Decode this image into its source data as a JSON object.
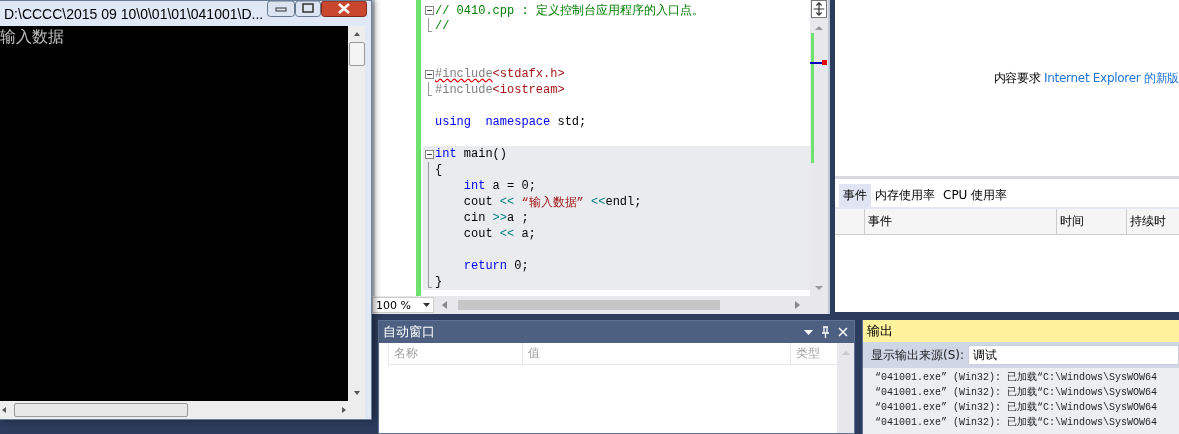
{
  "console": {
    "title": "D:\\CCCC\\2015 09 10\\0\\01\\01\\041001\\D...",
    "text": "输入数据"
  },
  "editor": {
    "regions": [
      {
        "shaded": false,
        "lines": [
          {
            "kind": "start",
            "tokens": [
              {
                "kind": "comment",
                "text": "// 0410.cpp : 定义控制台应用程序的入口点。",
                "error": false
              }
            ]
          },
          {
            "kind": "end",
            "tokens": [
              {
                "kind": "comment",
                "text": "//",
                "error": false
              }
            ]
          },
          {
            "kind": "plain"
          },
          {
            "kind": "plain"
          },
          {
            "kind": "start",
            "tokens": [
              {
                "kind": "preproc",
                "text": "#include",
                "error": true
              },
              {
                "kind": "string",
                "text": "<stdafx.h>",
                "error": false
              }
            ]
          },
          {
            "kind": "end",
            "tokens": [
              {
                "kind": "preproc",
                "text": "#include",
                "error": false
              },
              {
                "kind": "string",
                "text": "<iostream>",
                "error": false
              }
            ]
          },
          {
            "kind": "plain"
          },
          {
            "kind": "plain",
            "tokens": [
              {
                "kind": "keyword",
                "text": "using",
                "error": false
              },
              {
                "kind": "keyword",
                "text": "  namespace",
                "error": false
              },
              {
                "kind": "plain",
                "text": " std;",
                "error": false
              }
            ]
          },
          {
            "kind": "plain"
          }
        ]
      },
      {
        "shaded": true,
        "lines": [
          {
            "kind": "start",
            "tokens": [
              {
                "kind": "keyword",
                "text": "int",
                "error": false
              },
              {
                "kind": "plain",
                "text": " main()",
                "error": false
              }
            ]
          },
          {
            "kind": "inner",
            "tokens": [
              {
                "kind": "plain",
                "text": "{",
                "error": false
              }
            ]
          },
          {
            "kind": "inner",
            "tokens": [
              {
                "kind": "keyword",
                "text": "    int",
                "error": false
              },
              {
                "kind": "plain",
                "text": " a = 0;",
                "error": false
              }
            ]
          },
          {
            "kind": "inner",
            "tokens": [
              {
                "kind": "plain",
                "text": "    cout ",
                "error": false
              },
              {
                "kind": "operator",
                "text": "<<",
                "error": false
              },
              {
                "kind": "string",
                "text": " “输入数据”",
                "error": false
              },
              {
                "kind": "operator",
                "text": " <<",
                "error": false
              },
              {
                "kind": "plain",
                "text": "endl;",
                "error": false
              }
            ]
          },
          {
            "kind": "inner",
            "tokens": [
              {
                "kind": "plain",
                "text": "    cin ",
                "error": false
              },
              {
                "kind": "operator",
                "text": ">>",
                "error": false
              },
              {
                "kind": "plain",
                "text": "a ;",
                "error": false
              }
            ]
          },
          {
            "kind": "inner",
            "tokens": [
              {
                "kind": "plain",
                "text": "    cout ",
                "error": false
              },
              {
                "kind": "operator",
                "text": "<<",
                "error": false
              },
              {
                "kind": "plain",
                "text": " a;",
                "error": false
              }
            ]
          },
          {
            "kind": "inner"
          },
          {
            "kind": "inner",
            "tokens": [
              {
                "kind": "keyword",
                "text": "    return",
                "error": false
              },
              {
                "kind": "plain",
                "text": " 0;",
                "error": false
              }
            ]
          },
          {
            "kind": "end",
            "tokens": [
              {
                "kind": "plain",
                "text": "}",
                "error": false
              }
            ]
          }
        ]
      }
    ],
    "zoom": "100 %"
  },
  "browser_panel": {
    "message": "内容要求",
    "link": "Internet Explorer 的新版"
  },
  "diagnostics": {
    "tabs": [
      {
        "label": "事件",
        "selected": true
      },
      {
        "label": "内存使用率",
        "selected": false
      },
      {
        "label": "CPU 使用率",
        "selected": false
      }
    ],
    "columns": [
      "事件",
      "时间",
      "持续时"
    ]
  },
  "autos": {
    "title": "自动窗口",
    "columns": [
      "名称",
      "值",
      "类型"
    ]
  },
  "output": {
    "title": "输出",
    "source_label": "显示输出来源(S):",
    "source": "调试",
    "lines": [
      "“041001.exe” (Win32): 已加载“C:\\Windows\\SysWOW64",
      "“041001.exe” (Win32): 已加载“C:\\Windows\\SysWOW64",
      "“041001.exe” (Win32): 已加载“C:\\Windows\\SysWOW64",
      "“041001.exe” (Win32): 已加载“C:\\Windows\\SysWOW64"
    ]
  }
}
